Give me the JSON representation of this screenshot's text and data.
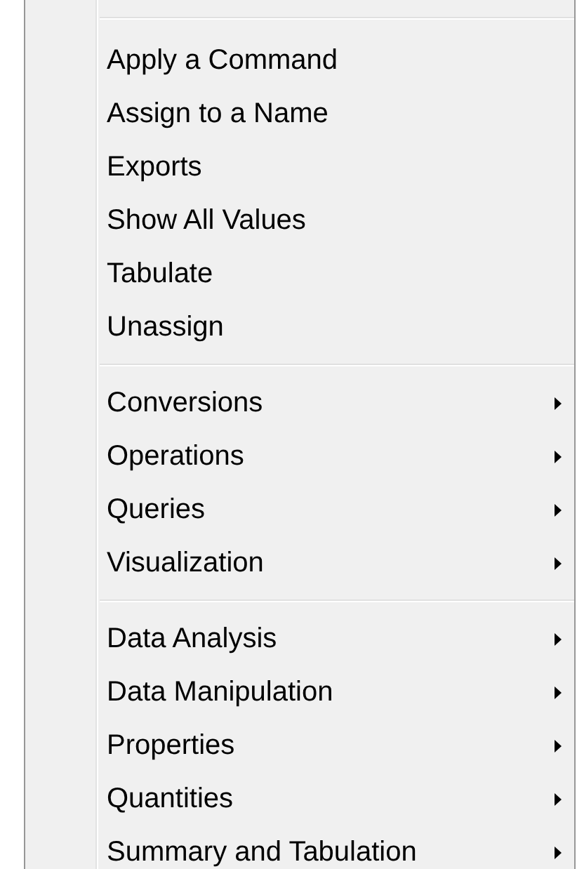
{
  "menu": {
    "groups": [
      {
        "items": [
          {
            "label": "Apply a Command",
            "submenu": false
          },
          {
            "label": "Assign to a Name",
            "submenu": false
          },
          {
            "label": "Exports",
            "submenu": false
          },
          {
            "label": "Show All Values",
            "submenu": false
          },
          {
            "label": "Tabulate",
            "submenu": false
          },
          {
            "label": "Unassign",
            "submenu": false
          }
        ]
      },
      {
        "items": [
          {
            "label": "Conversions",
            "submenu": true
          },
          {
            "label": "Operations",
            "submenu": true
          },
          {
            "label": "Queries",
            "submenu": true
          },
          {
            "label": "Visualization",
            "submenu": true
          }
        ]
      },
      {
        "items": [
          {
            "label": "Data Analysis",
            "submenu": true
          },
          {
            "label": "Data Manipulation",
            "submenu": true
          },
          {
            "label": "Properties",
            "submenu": true
          },
          {
            "label": "Quantities",
            "submenu": true
          },
          {
            "label": "Summary and Tabulation",
            "submenu": true
          }
        ]
      }
    ]
  }
}
